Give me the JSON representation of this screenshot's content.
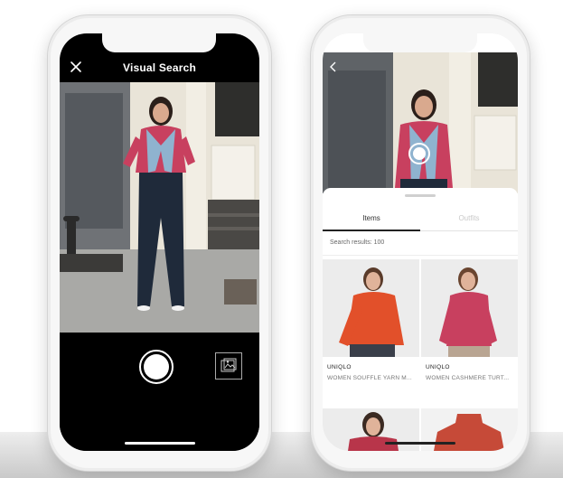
{
  "camera_screen": {
    "title": "Visual Search"
  },
  "results_screen": {
    "tabs": [
      {
        "label": "Items",
        "active": true
      },
      {
        "label": "Outfits",
        "active": false
      }
    ],
    "results_label": "Search results: 100",
    "products": [
      {
        "brand": "UNIQLO",
        "name": "WOMEN SOUFFLE YARN M...",
        "color": "#e2502a"
      },
      {
        "brand": "UNIQLO",
        "name": "WOMEN CASHMERE TURT...",
        "color": "#c8405f"
      },
      {
        "brand": "",
        "name": "",
        "color": "#b8354a"
      },
      {
        "brand": "",
        "name": "",
        "color": "#c64a38"
      }
    ]
  },
  "colors": {
    "accent_sweater": "#c8405f",
    "scarf": "#8fb3cf",
    "jeans": "#1f2a3a"
  }
}
